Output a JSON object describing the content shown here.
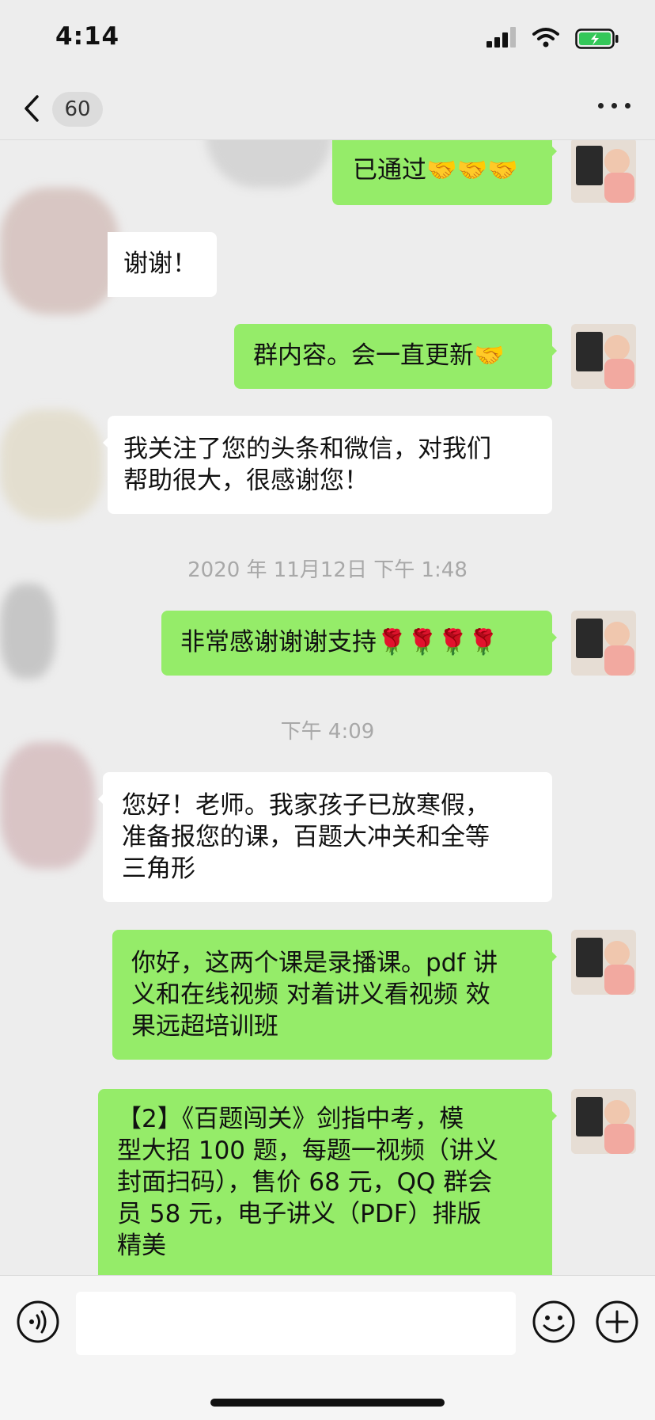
{
  "status_bar": {
    "time": "4:14"
  },
  "nav": {
    "unread_count": "60"
  },
  "messages": [
    {
      "side": "sent",
      "text": "已通过🤝🤝🤝"
    },
    {
      "side": "recv",
      "text": "谢谢！"
    },
    {
      "side": "sent",
      "text": "群内容。会一直更新🤝"
    },
    {
      "side": "recv",
      "lines": [
        "我关注了您的头条和微信，对我们",
        "帮助很大，很感谢您！"
      ]
    },
    {
      "side": "sent",
      "text": "非常感谢谢谢支持🌹🌹🌹🌹"
    },
    {
      "side": "recv",
      "lines": [
        "您好！老师。我家孩子已放寒假，",
        "准备报您的课，百题大冲关和全等",
        "三角形"
      ]
    },
    {
      "side": "sent",
      "lines": [
        "你好，这两个课是录播课。pdf 讲",
        "义和在线视频 对着讲义看视频 效",
        "果远超培训班"
      ]
    },
    {
      "side": "sent",
      "lines": [
        "【2】《百题闯关》剑指中考，模",
        "型大招 100 题，每题一视频（讲义",
        "封面扫码），售价 68 元，QQ 群会",
        "员 58 元，电子讲义（PDF）排版",
        "精美"
      ]
    }
  ],
  "timestamps": [
    "2020 年 11月12日 下午 1:48",
    "下午 4:09"
  ],
  "input": {
    "value": ""
  },
  "colors": {
    "sent_bubble": "#95ec69",
    "recv_bubble": "#ffffff",
    "background": "#ededed",
    "battery": "#34c759"
  },
  "icons": [
    "signal-icon",
    "wifi-icon",
    "battery-charging-icon",
    "back-chevron-icon",
    "more-dots-icon",
    "voice-icon",
    "emoji-icon",
    "plus-icon"
  ]
}
